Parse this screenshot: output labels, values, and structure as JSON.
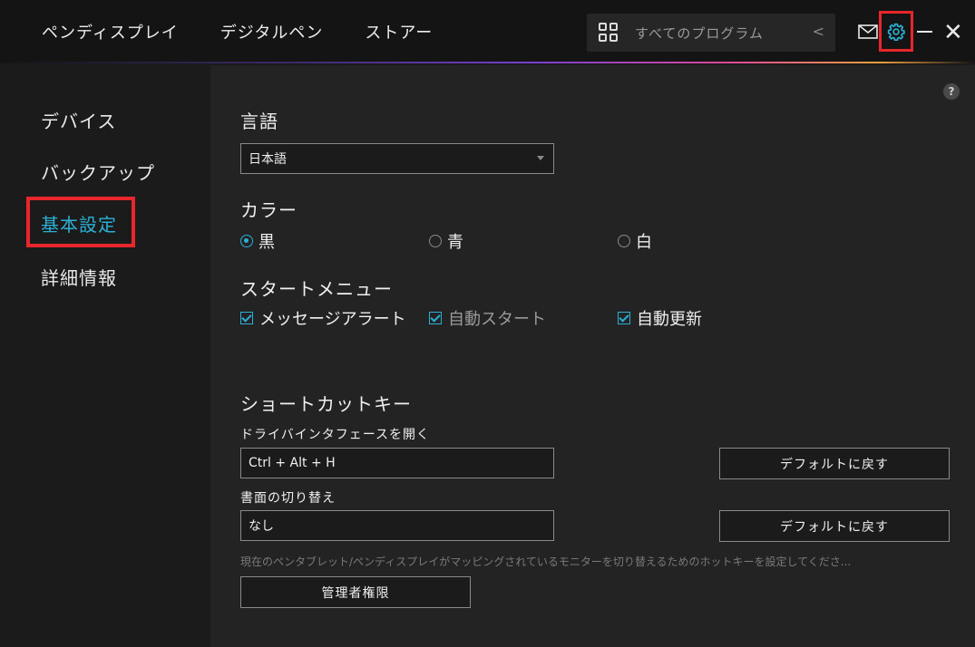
{
  "topnav": {
    "items": [
      "ペンディスプレイ",
      "デジタルペン",
      "ストアー"
    ]
  },
  "program_selector": {
    "label": "すべてのプログラム",
    "chevron": "<"
  },
  "window_controls": {
    "mail_icon": "mail-icon",
    "settings_icon": "gear-icon",
    "minimize_icon": "minimize-icon",
    "close_icon": "close-icon",
    "close_glyph": "✕"
  },
  "sidebar": {
    "items": [
      {
        "label": "デバイス"
      },
      {
        "label": "バックアップ"
      },
      {
        "label": "基本設定"
      },
      {
        "label": "詳細情報"
      }
    ],
    "active_index": 2
  },
  "content": {
    "help_glyph": "?",
    "language": {
      "title": "言語",
      "selected": "日本語"
    },
    "color": {
      "title": "カラー",
      "options": [
        {
          "label": "黒",
          "checked": true
        },
        {
          "label": "青",
          "checked": false
        },
        {
          "label": "白",
          "checked": false
        }
      ]
    },
    "start_menu": {
      "title": "スタートメニュー",
      "options": [
        {
          "label": "メッセージアラート",
          "checked": true,
          "enabled": true
        },
        {
          "label": "自動スタート",
          "checked": true,
          "enabled": false
        },
        {
          "label": "自動更新",
          "checked": true,
          "enabled": true
        }
      ]
    },
    "shortcuts": {
      "title": "ショートカットキー",
      "items": [
        {
          "label": "ドライバインタフェースを開く",
          "value": "Ctrl + Alt + H",
          "reset_label": "デフォルトに戻す"
        },
        {
          "label": "書面の切り替え",
          "value": "なし",
          "reset_label": "デフォルトに戻す"
        }
      ],
      "hint": "現在のペンタブレット/ペンディスプレイがマッピングされているモニターを切り替えるためのホットキーを設定してくださ...",
      "admin_button": "管理者権限"
    }
  },
  "colors": {
    "accent": "#2bb0d6",
    "highlight": "#e8262b",
    "background": "#232323"
  }
}
